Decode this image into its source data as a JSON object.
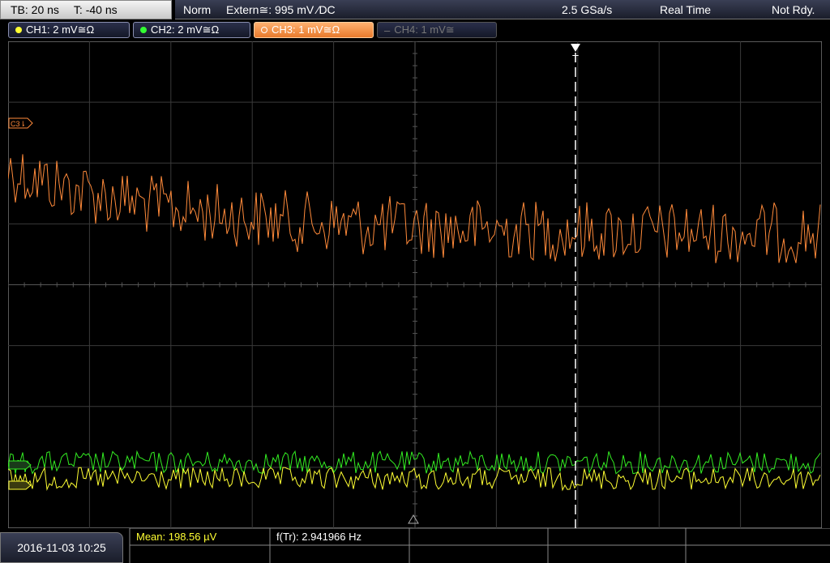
{
  "status": {
    "timebase": "TB: 20 ns",
    "trigger_time": "T: -40 ns",
    "trigger_mode": "Norm",
    "trigger_source": "Extern≅: 995 mV ⁄DC",
    "sample_rate": "2.5 GSa/s",
    "acq_mode": "Real Time",
    "state": "Not Rdy."
  },
  "channels": [
    {
      "label": "CH1: 2 mV≅Ω",
      "color": "#ffff33"
    },
    {
      "label": "CH2: 2 mV≅Ω",
      "color": "#33ff33"
    },
    {
      "label": "CH3: 1 mV≅Ω",
      "color": "#ff9a40"
    },
    {
      "label": "CH4: 1 mV≅",
      "color": "#777777"
    }
  ],
  "markers": {
    "c3": "C3⇂",
    "trigger": "T"
  },
  "measurements": {
    "mean": "Mean: 198.56 µV",
    "freq": "f(Tr): 2.941966 Hz"
  },
  "datetime": "2016-11-03 10:25"
}
